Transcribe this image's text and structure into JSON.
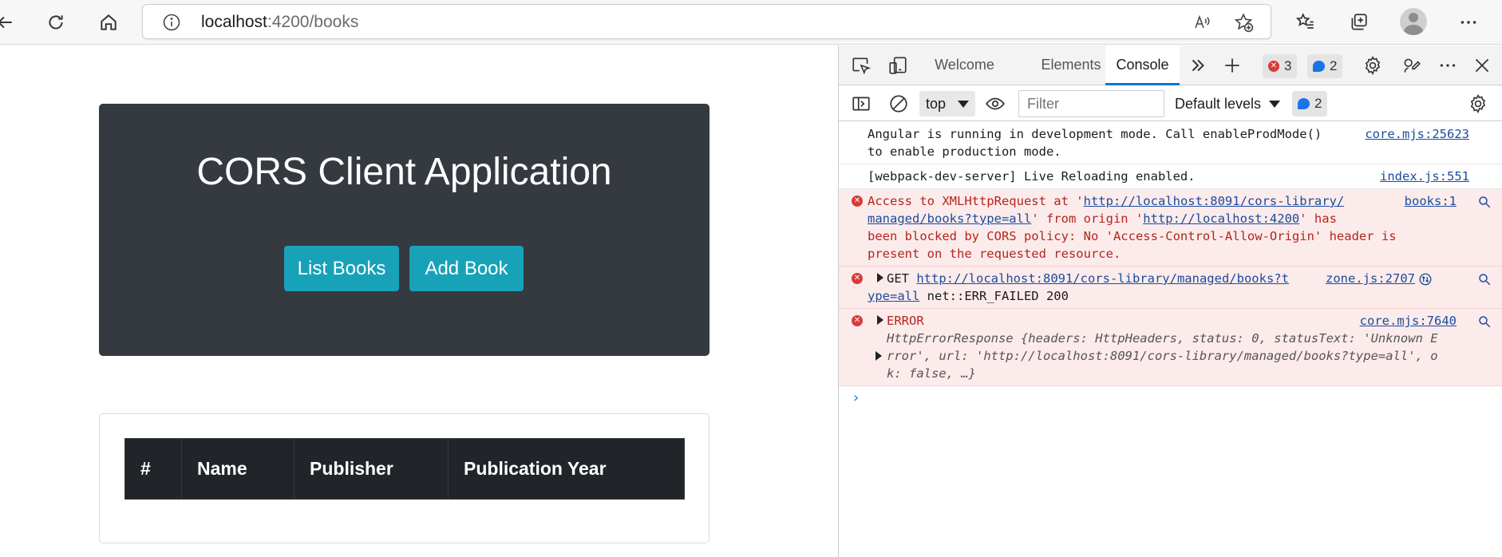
{
  "browser": {
    "url_host": "localhost",
    "url_rest": ":4200/books",
    "icons": [
      "back-arrow-icon",
      "refresh-icon",
      "home-icon",
      "info-icon",
      "read-aloud-icon",
      "add-favorite-icon",
      "favorites-icon",
      "collections-icon",
      "profile-icon",
      "more-icon"
    ]
  },
  "page": {
    "title": "CORS Client Application",
    "buttons": {
      "list_books": "List Books",
      "add_book": "Add Book"
    },
    "table_headers": [
      "#",
      "Name",
      "Publisher",
      "Publication Year"
    ]
  },
  "devtools": {
    "tabs": {
      "welcome": "Welcome",
      "elements": "Elements",
      "console": "Console"
    },
    "error_count": "3",
    "info_count": "2",
    "context": "top",
    "filter_placeholder": "Filter",
    "levels": "Default levels",
    "issues_count": "2",
    "messages": {
      "m1_text_a": "Angular is running in development mode. Call enableProdMode()",
      "m1_text_b": "to enable production mode.",
      "m1_src": "core.mjs:25623",
      "m2_text": "[webpack-dev-server] Live Reloading enabled.",
      "m2_src": "index.js:551",
      "m3_a": "Access to XMLHttpRequest at '",
      "m3_link1a": "http://localhost:8091/cors-library/",
      "m3_link1b": "managed/books?type=all",
      "m3_b": "' from origin '",
      "m3_link2": "http://localhost:4200",
      "m3_c": "' has",
      "m3_d": "been blocked by CORS policy: No 'Access-Control-Allow-Origin' header is",
      "m3_e": "present on the requested resource.",
      "m3_src": "books:1",
      "m4_verb": "GET",
      "m4_link_a": "http://localhost:8091/cors-library/managed/books?t",
      "m4_link_b": "ype=all",
      "m4_rest": " net::ERR_FAILED 200",
      "m4_src": "zone.js:2707",
      "m5_title": "ERROR",
      "m5_src": "core.mjs:7640",
      "m5_l1": "HttpErrorResponse {headers: HttpHeaders, status: 0, statusText: 'Unknown E",
      "m5_l2": "rror', url: 'http://localhost:8091/cors-library/managed/books?type=all', o",
      "m5_l3": "k: false, …}"
    },
    "prompt": "›"
  },
  "colors": {
    "jumbotron": "#343a40",
    "button": "#17a2b8",
    "table_head": "#212529",
    "error_bg": "#fcebeb",
    "error_text": "#b3261e",
    "accent": "#0078d4"
  }
}
